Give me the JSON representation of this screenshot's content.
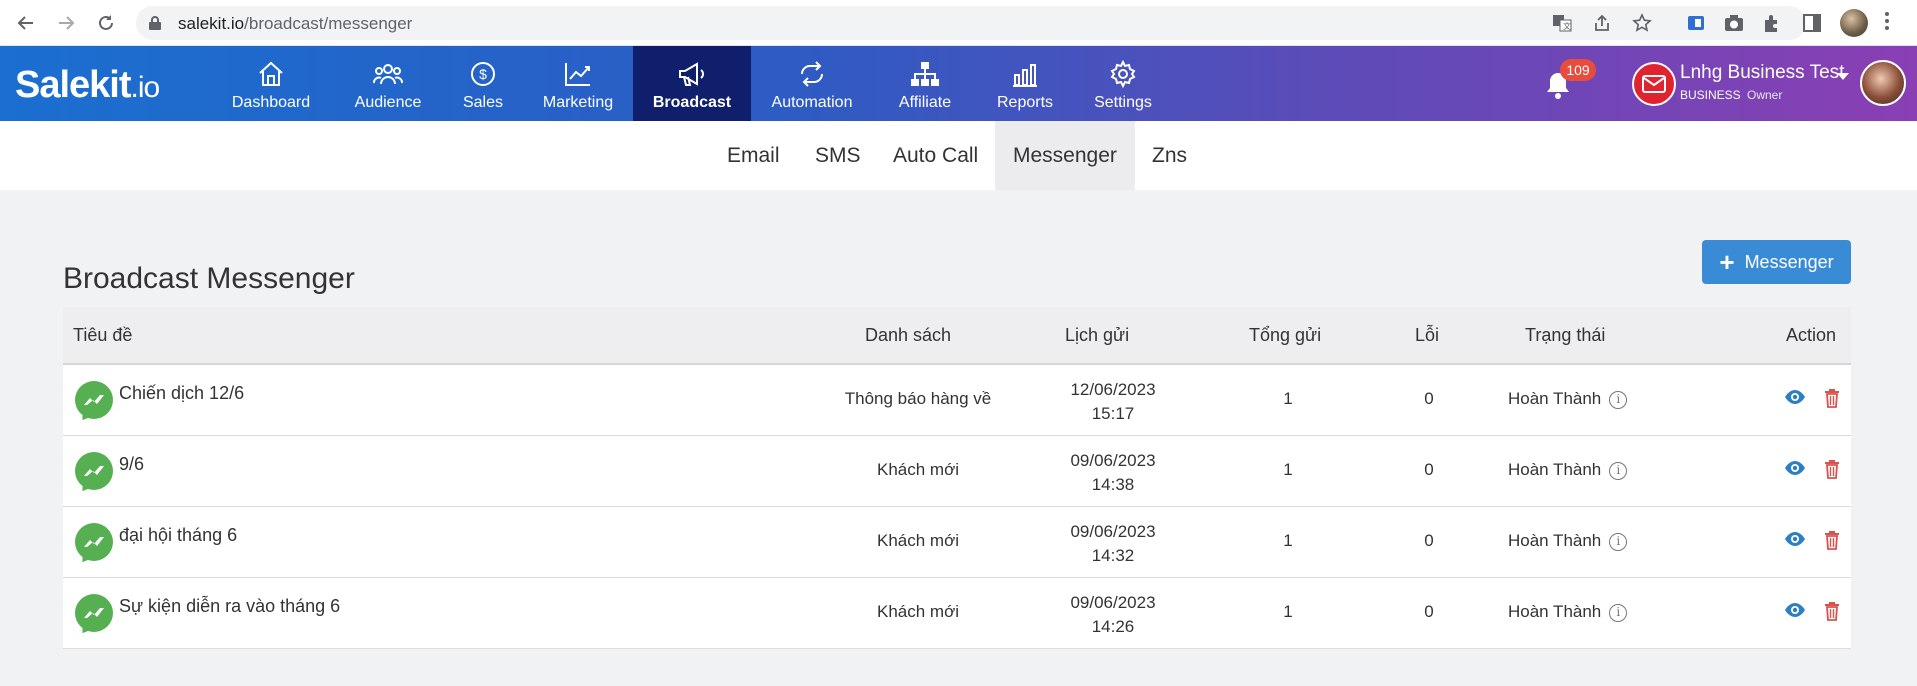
{
  "browser": {
    "url_host": "salekit.io",
    "url_path": "/broadcast/messenger"
  },
  "app": {
    "logo_main": "Salekit",
    "logo_suffix": ".io",
    "nav": [
      {
        "label": "Dashboard",
        "icon": "home-icon"
      },
      {
        "label": "Audience",
        "icon": "users-icon"
      },
      {
        "label": "Sales",
        "icon": "dollar-icon"
      },
      {
        "label": "Marketing",
        "icon": "chart-line-icon"
      },
      {
        "label": "Broadcast",
        "icon": "megaphone-icon",
        "active": true
      },
      {
        "label": "Automation",
        "icon": "repeat-icon"
      },
      {
        "label": "Affiliate",
        "icon": "sitemap-icon"
      },
      {
        "label": "Reports",
        "icon": "bar-chart-icon"
      },
      {
        "label": "Settings",
        "icon": "gear-icon"
      }
    ],
    "notifications_count": "109",
    "business_name": "Lnhg Business Test",
    "business_type": "BUSINESS",
    "business_role": "Owner"
  },
  "subnav": {
    "tabs": [
      "Email",
      "SMS",
      "Auto Call",
      "Messenger",
      "Zns"
    ],
    "active": "Messenger"
  },
  "page": {
    "title": "Broadcast Messenger",
    "add_button": "Messenger"
  },
  "table": {
    "headers": {
      "title": "Tiêu đề",
      "list": "Danh sách",
      "schedule": "Lịch gửi",
      "total": "Tổng gửi",
      "errors": "Lỗi",
      "status": "Trạng thái",
      "action": "Action"
    },
    "rows": [
      {
        "title": "Chiến dịch 12/6",
        "list": "Thông báo hàng về",
        "date": "12/06/2023",
        "time": "15:17",
        "total": "1",
        "errors": "0",
        "status": "Hoàn Thành"
      },
      {
        "title": "9/6",
        "list": "Khách mới",
        "date": "09/06/2023",
        "time": "14:38",
        "total": "1",
        "errors": "0",
        "status": "Hoàn Thành"
      },
      {
        "title": "đại hội tháng 6",
        "list": "Khách mới",
        "date": "09/06/2023",
        "time": "14:32",
        "total": "1",
        "errors": "0",
        "status": "Hoàn Thành"
      },
      {
        "title": "Sự kiện diễn ra vào tháng 6",
        "list": "Khách mới",
        "date": "09/06/2023",
        "time": "14:26",
        "total": "1",
        "errors": "0",
        "status": "Hoàn Thành"
      }
    ]
  },
  "colors": {
    "primary_button": "#3a8bd6",
    "messenger_green": "#56b052",
    "view_icon": "#2d7fc1",
    "delete_icon": "#d9534f",
    "nav_active": "#0f1f6b"
  }
}
